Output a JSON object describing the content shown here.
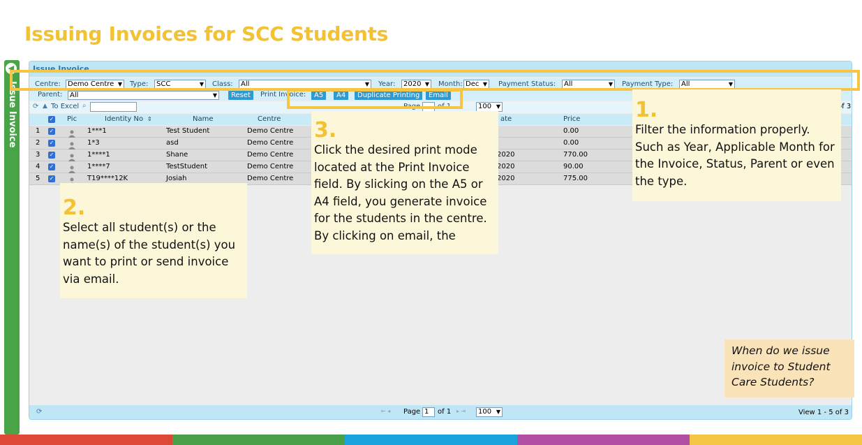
{
  "slide": {
    "title": "Issuing Invoices for SCC Students",
    "side_tab_label": "Issue Invoice"
  },
  "panel": {
    "title": "Issue Invoice",
    "filters": {
      "centre_label": "Centre:",
      "centre_value": "Demo Centre",
      "type_label": "Type:",
      "type_value": "SCC",
      "class_label": "Class:",
      "class_value": "All",
      "year_label": "Year:",
      "year_value": "2020",
      "month_label": "Month:",
      "month_value": "Dec",
      "payment_status_label": "Payment Status:",
      "payment_status_value": "All",
      "payment_type_label": "Payment Type:",
      "payment_type_value": "All",
      "parent_label": "Parent:",
      "parent_value": "All"
    },
    "buttons": {
      "reset": "Reset",
      "print_invoice_label": "Print Invoice:",
      "a5": "A5",
      "a4": "A4",
      "duplicate_printing": "Duplicate Printing",
      "email": "Email"
    },
    "toolbar": {
      "to_excel": "To Excel",
      "page_label": "Page",
      "page_of": "of 1",
      "page_size": "100",
      "of_count": "of 3"
    },
    "grid": {
      "columns": [
        "Pic",
        "Identity No",
        "Name",
        "Centre",
        "ate",
        "Price"
      ],
      "rows": [
        {
          "num": "1",
          "identity": "1***1",
          "name": "Test Student",
          "centre": "Demo Centre",
          "date": "",
          "price": "0.00"
        },
        {
          "num": "2",
          "identity": "1*3",
          "name": "asd",
          "centre": "Demo Centre",
          "date": "",
          "price": "0.00"
        },
        {
          "num": "3",
          "identity": "1****1",
          "name": "Shane",
          "centre": "Demo Centre",
          "date": "2020",
          "price": "770.00"
        },
        {
          "num": "4",
          "identity": "1****7",
          "name": "TestStudent",
          "centre": "Demo Centre",
          "date": "2020",
          "price": "90.00"
        },
        {
          "num": "5",
          "identity": "T19****12K",
          "name": "Josiah",
          "centre": "Demo Centre",
          "date": "2020",
          "price": "775.00"
        }
      ]
    },
    "footer": {
      "page_label": "Page",
      "page_value": "1",
      "page_of": "of 1",
      "page_size": "100",
      "view_text": "View 1 - 5 of 3"
    }
  },
  "callouts": {
    "one": {
      "num": "1.",
      "text": "Filter the information properly. Such as Year, Applicable Month for the Invoice, Status, Parent or even the type."
    },
    "two": {
      "num": "2.",
      "text": "Select all student(s) or the name(s) of the student(s) you want to print or send invoice via email."
    },
    "three": {
      "num": "3.",
      "text": "Click the desired print mode located at the Print Invoice field. By slicking on the A5 or A4 field, you generate invoice for the students in the centre. By clicking on email, the"
    },
    "question": "When do we issue invoice to Student Care Students?"
  },
  "colors": {
    "title": "#f2c232",
    "highlight": "#f6c543",
    "side_tab": "#48a447",
    "stripes": [
      "#dc4a36",
      "#4aa048",
      "#1aa3dc",
      "#b14fa5",
      "#f6c543"
    ]
  }
}
